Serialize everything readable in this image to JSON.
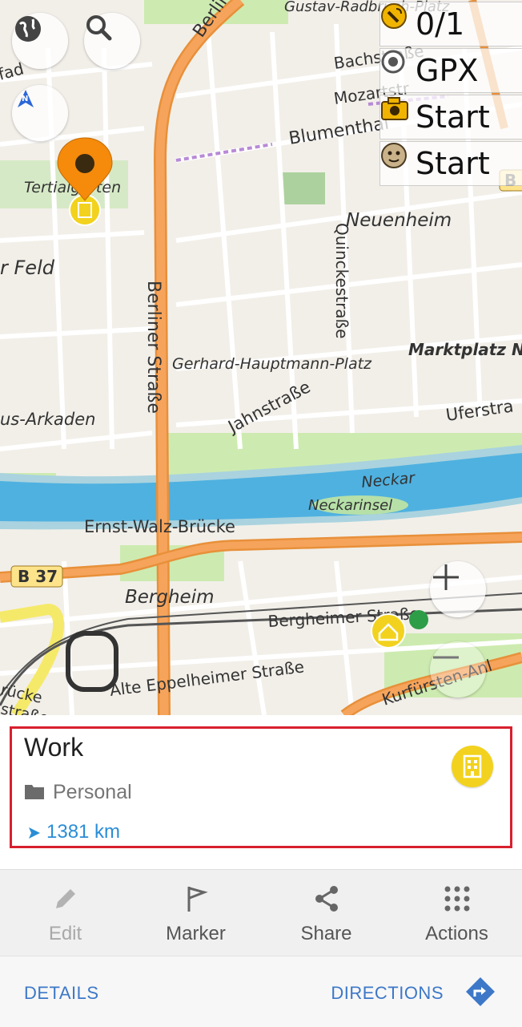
{
  "map": {
    "street_labels": {
      "gustav": "Gustav-Radbruch-Platz",
      "bachstrasse": "Bachstraße",
      "mozartstr": "Mozartstr",
      "blumenthal": "Blumenthal",
      "berlin_top": "Berlin",
      "neuenheim": "Neuenheim",
      "quinckestrasse": "Quinckestraße",
      "berliner_strasse": "Berliner Straße",
      "feld": "r Feld",
      "tertial": "Tertialgarten",
      "marktplatz": "Marktplatz N",
      "gerhard": "Gerhard-Hauptmann-Platz",
      "jahnstrasse": "Jahnstraße",
      "uferstra": "Uferstra",
      "arkaden": "us-Arkaden",
      "neckar": "Neckar",
      "neckarinsel": "Neckarinsel",
      "ernst_walz": "Ernst-Walz-Brücke",
      "b37": "B 37",
      "b_right": "B",
      "bergheim": "Bergheim",
      "bergheimer": "Bergheimer Straße",
      "alte_eppel": "Alte Eppelheimer Straße",
      "kurfuersten": "Kurfürsten-Anl",
      "bruecke": "rücke",
      "strasse_bottom": "straße",
      "fad": "fad"
    },
    "widgets": {
      "counter": "0/1",
      "gpx": "GPX",
      "photo": "Start",
      "audio": "Start"
    }
  },
  "card": {
    "title": "Work",
    "folder": "Personal",
    "distance": "1381 km",
    "highlight_color": "#d8202d"
  },
  "actions": [
    {
      "label": "Edit",
      "icon": "pencil-icon",
      "enabled": false
    },
    {
      "label": "Marker",
      "icon": "flag-icon",
      "enabled": true
    },
    {
      "label": "Share",
      "icon": "share-icon",
      "enabled": true
    },
    {
      "label": "Actions",
      "icon": "grid-dots-icon",
      "enabled": true
    }
  ],
  "bottom": {
    "details": "DETAILS",
    "directions": "DIRECTIONS"
  }
}
